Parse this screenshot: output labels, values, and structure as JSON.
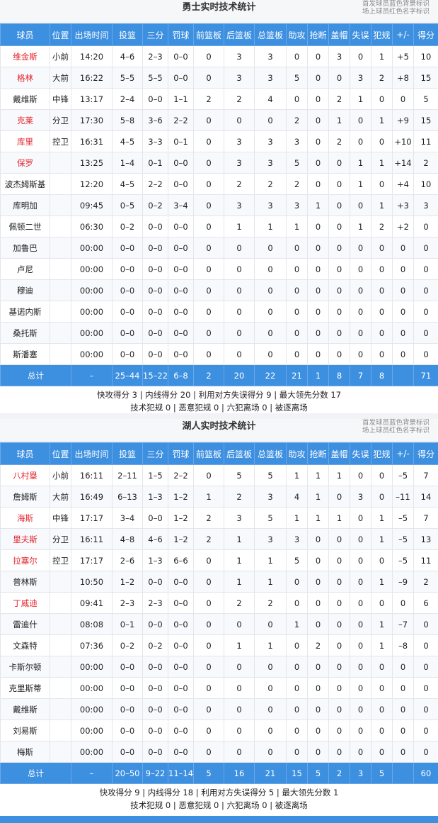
{
  "legend": {
    "line1": "首发球员蓝色背景标识",
    "line2": "场上球员红色名字标识"
  },
  "headers": [
    "球员",
    "位置",
    "出场时间",
    "投篮",
    "三分",
    "罚球",
    "前篮板",
    "后篮板",
    "总篮板",
    "助攻",
    "抢断",
    "盖帽",
    "失误",
    "犯规",
    "+/-",
    "得分"
  ],
  "teams": [
    {
      "title": "勇士实时技术统计",
      "players": [
        {
          "name": "维金斯",
          "red": true,
          "cells": [
            "维金斯",
            "小前",
            "14:20",
            "4–6",
            "2–3",
            "0–0",
            "0",
            "3",
            "3",
            "0",
            "0",
            "3",
            "0",
            "1",
            "+5",
            "10"
          ]
        },
        {
          "name": "格林",
          "red": true,
          "cells": [
            "格林",
            "大前",
            "16:22",
            "5–5",
            "5–5",
            "0–0",
            "0",
            "3",
            "3",
            "5",
            "0",
            "0",
            "3",
            "2",
            "+8",
            "15"
          ]
        },
        {
          "name": "戴维斯",
          "red": false,
          "cells": [
            "戴维斯",
            "中锋",
            "13:17",
            "2–4",
            "0–0",
            "1–1",
            "2",
            "2",
            "4",
            "0",
            "0",
            "2",
            "1",
            "0",
            "0",
            "5"
          ]
        },
        {
          "name": "克莱",
          "red": true,
          "cells": [
            "克莱",
            "分卫",
            "17:30",
            "5–8",
            "3–6",
            "2–2",
            "0",
            "0",
            "0",
            "2",
            "0",
            "1",
            "0",
            "1",
            "+9",
            "15"
          ]
        },
        {
          "name": "库里",
          "red": true,
          "cells": [
            "库里",
            "控卫",
            "16:31",
            "4–5",
            "3–3",
            "0–1",
            "0",
            "3",
            "3",
            "3",
            "0",
            "2",
            "0",
            "0",
            "+10",
            "11"
          ]
        },
        {
          "name": "保罗",
          "red": true,
          "cells": [
            "保罗",
            "",
            "13:25",
            "1–4",
            "0–1",
            "0–0",
            "0",
            "3",
            "3",
            "5",
            "0",
            "0",
            "1",
            "1",
            "+14",
            "2"
          ]
        },
        {
          "name": "波杰姆斯基",
          "red": false,
          "cells": [
            "波杰姆斯基",
            "",
            "12:20",
            "4–5",
            "2–2",
            "0–0",
            "0",
            "2",
            "2",
            "2",
            "0",
            "0",
            "1",
            "0",
            "+4",
            "10"
          ]
        },
        {
          "name": "库明加",
          "red": false,
          "cells": [
            "库明加",
            "",
            "09:45",
            "0–5",
            "0–2",
            "3–4",
            "0",
            "3",
            "3",
            "3",
            "1",
            "0",
            "0",
            "1",
            "+3",
            "3"
          ]
        },
        {
          "name": "佩顿二世",
          "red": false,
          "cells": [
            "佩顿二世",
            "",
            "06:30",
            "0–2",
            "0–0",
            "0–0",
            "0",
            "1",
            "1",
            "1",
            "0",
            "0",
            "1",
            "2",
            "+2",
            "0"
          ]
        },
        {
          "name": "加鲁巴",
          "red": false,
          "cells": [
            "加鲁巴",
            "",
            "00:00",
            "0–0",
            "0–0",
            "0–0",
            "0",
            "0",
            "0",
            "0",
            "0",
            "0",
            "0",
            "0",
            "0",
            "0"
          ]
        },
        {
          "name": "卢尼",
          "red": false,
          "cells": [
            "卢尼",
            "",
            "00:00",
            "0–0",
            "0–0",
            "0–0",
            "0",
            "0",
            "0",
            "0",
            "0",
            "0",
            "0",
            "0",
            "0",
            "0"
          ]
        },
        {
          "name": "穆迪",
          "red": false,
          "cells": [
            "穆迪",
            "",
            "00:00",
            "0–0",
            "0–0",
            "0–0",
            "0",
            "0",
            "0",
            "0",
            "0",
            "0",
            "0",
            "0",
            "0",
            "0"
          ]
        },
        {
          "name": "基诺内斯",
          "red": false,
          "cells": [
            "基诺内斯",
            "",
            "00:00",
            "0–0",
            "0–0",
            "0–0",
            "0",
            "0",
            "0",
            "0",
            "0",
            "0",
            "0",
            "0",
            "0",
            "0"
          ]
        },
        {
          "name": "桑托斯",
          "red": false,
          "cells": [
            "桑托斯",
            "",
            "00:00",
            "0–0",
            "0–0",
            "0–0",
            "0",
            "0",
            "0",
            "0",
            "0",
            "0",
            "0",
            "0",
            "0",
            "0"
          ]
        },
        {
          "name": "斯潘塞",
          "red": false,
          "cells": [
            "斯潘塞",
            "",
            "00:00",
            "0–0",
            "0–0",
            "0–0",
            "0",
            "0",
            "0",
            "0",
            "0",
            "0",
            "0",
            "0",
            "0",
            "0"
          ]
        }
      ],
      "total": [
        "总计",
        "",
        "–",
        "25–44",
        "15–22",
        "6–8",
        "2",
        "20",
        "22",
        "21",
        "1",
        "8",
        "7",
        "8",
        "",
        "71"
      ],
      "summary1": "快攻得分 3 | 内线得分 20 | 利用对方失误得分 9 | 最大领先分数 17",
      "summary2": "技术犯规 0 | 恶意犯规 0 | 六犯离场 0 | 被逐离场"
    },
    {
      "title": "湖人实时技术统计",
      "players": [
        {
          "name": "八村塁",
          "red": true,
          "cells": [
            "八村塁",
            "小前",
            "16:11",
            "2–11",
            "1–5",
            "2–2",
            "0",
            "5",
            "5",
            "1",
            "1",
            "1",
            "0",
            "0",
            "–5",
            "7"
          ]
        },
        {
          "name": "詹姆斯",
          "red": false,
          "cells": [
            "詹姆斯",
            "大前",
            "16:49",
            "6–13",
            "1–3",
            "1–2",
            "1",
            "2",
            "3",
            "4",
            "1",
            "0",
            "3",
            "0",
            "–11",
            "14"
          ]
        },
        {
          "name": "海斯",
          "red": true,
          "cells": [
            "海斯",
            "中锋",
            "17:17",
            "3–4",
            "0–0",
            "1–2",
            "2",
            "3",
            "5",
            "1",
            "1",
            "1",
            "0",
            "1",
            "–5",
            "7"
          ]
        },
        {
          "name": "里夫斯",
          "red": true,
          "cells": [
            "里夫斯",
            "分卫",
            "16:11",
            "4–8",
            "4–6",
            "1–2",
            "2",
            "1",
            "3",
            "3",
            "0",
            "0",
            "0",
            "1",
            "–5",
            "13"
          ]
        },
        {
          "name": "拉塞尔",
          "red": true,
          "cells": [
            "拉塞尔",
            "控卫",
            "17:17",
            "2–6",
            "1–3",
            "6–6",
            "0",
            "1",
            "1",
            "5",
            "0",
            "0",
            "0",
            "0",
            "–5",
            "11"
          ]
        },
        {
          "name": "普林斯",
          "red": false,
          "cells": [
            "普林斯",
            "",
            "10:50",
            "1–2",
            "0–0",
            "0–0",
            "0",
            "1",
            "1",
            "0",
            "0",
            "0",
            "0",
            "1",
            "–9",
            "2"
          ]
        },
        {
          "name": "丁威迪",
          "red": true,
          "cells": [
            "丁威迪",
            "",
            "09:41",
            "2–3",
            "2–3",
            "0–0",
            "0",
            "2",
            "2",
            "0",
            "0",
            "0",
            "0",
            "0",
            "0",
            "6"
          ]
        },
        {
          "name": "雷迪什",
          "red": false,
          "cells": [
            "雷迪什",
            "",
            "08:08",
            "0–1",
            "0–0",
            "0–0",
            "0",
            "0",
            "0",
            "1",
            "0",
            "0",
            "0",
            "1",
            "–7",
            "0"
          ]
        },
        {
          "name": "文森特",
          "red": false,
          "cells": [
            "文森特",
            "",
            "07:36",
            "0–2",
            "0–2",
            "0–0",
            "0",
            "1",
            "1",
            "0",
            "2",
            "0",
            "0",
            "1",
            "–8",
            "0"
          ]
        },
        {
          "name": "卡斯尔顿",
          "red": false,
          "cells": [
            "卡斯尔顿",
            "",
            "00:00",
            "0–0",
            "0–0",
            "0–0",
            "0",
            "0",
            "0",
            "0",
            "0",
            "0",
            "0",
            "0",
            "0",
            "0"
          ]
        },
        {
          "name": "克里斯蒂",
          "red": false,
          "cells": [
            "克里斯蒂",
            "",
            "00:00",
            "0–0",
            "0–0",
            "0–0",
            "0",
            "0",
            "0",
            "0",
            "0",
            "0",
            "0",
            "0",
            "0",
            "0"
          ]
        },
        {
          "name": "戴维斯",
          "red": false,
          "cells": [
            "戴维斯",
            "",
            "00:00",
            "0–0",
            "0–0",
            "0–0",
            "0",
            "0",
            "0",
            "0",
            "0",
            "0",
            "0",
            "0",
            "0",
            "0"
          ]
        },
        {
          "name": "刘易斯",
          "red": false,
          "cells": [
            "刘易斯",
            "",
            "00:00",
            "0–0",
            "0–0",
            "0–0",
            "0",
            "0",
            "0",
            "0",
            "0",
            "0",
            "0",
            "0",
            "0",
            "0"
          ]
        },
        {
          "name": "梅斯",
          "red": false,
          "cells": [
            "梅斯",
            "",
            "00:00",
            "0–0",
            "0–0",
            "0–0",
            "0",
            "0",
            "0",
            "0",
            "0",
            "0",
            "0",
            "0",
            "0",
            "0"
          ]
        }
      ],
      "total": [
        "总计",
        "",
        "–",
        "20–50",
        "9–22",
        "11–14",
        "5",
        "16",
        "21",
        "15",
        "5",
        "2",
        "3",
        "5",
        "",
        "60"
      ],
      "summary1": "快攻得分 9 | 内线得分 18 | 利用对方失误得分 5 | 最大领先分数 1",
      "summary2": "技术犯规 0 | 恶意犯规 0 | 六犯离场 0 | 被逐离场"
    }
  ],
  "colors": {
    "header_blue": "#3d8fe0",
    "on_court_red": "#e4262d"
  }
}
